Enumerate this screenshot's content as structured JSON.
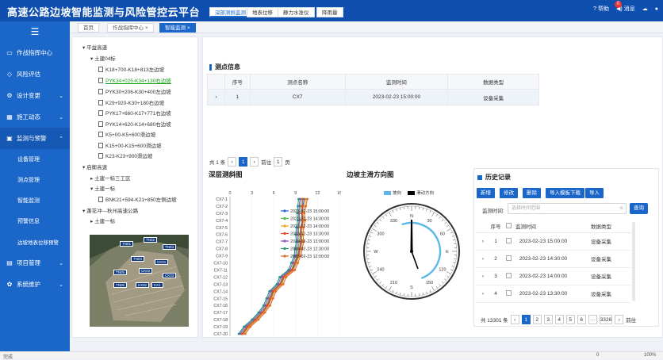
{
  "app": {
    "title": "高速公路边坡智能监测与风险管控云平台",
    "help": "帮助",
    "messages": "消息",
    "message_count": "0"
  },
  "sidebar": {
    "items": [
      {
        "label": "作战指挥中心",
        "icon": "monitor-icon"
      },
      {
        "label": "风险评估",
        "icon": "shield-icon"
      },
      {
        "label": "设计变更",
        "icon": "gear-icon"
      },
      {
        "label": "施工动态",
        "icon": "grid-icon"
      },
      {
        "label": "监测与预警",
        "icon": "alarm-icon"
      },
      {
        "label": "项目管理",
        "icon": "folder-icon"
      },
      {
        "label": "系统维护",
        "icon": "wrench-icon"
      }
    ],
    "sub_items": [
      "设备管理",
      "测点管理",
      "智能监测",
      "预警信息",
      "边坡地表位移预警"
    ]
  },
  "tabs": [
    "首页",
    "作战指挥中心",
    "智能监测"
  ],
  "tree": {
    "nodes": [
      "平益高速",
      "土建04标",
      "K18+700-K18+813左边坡",
      "PYK34+025-K34+130右边坡",
      "PYK30+206-K30+400左边坡",
      "K29+920-K30+180右边坡",
      "PYK17+660-K17+771右边坡",
      "PYK14+620-K14+680右边坡",
      "K5+00-K5+600滑边坡",
      "K15+00-K15+600滑边坡",
      "K23-K23+900滑边坡",
      "启衡高速",
      "土建一标三工区",
      "土建一标",
      "BNK21+594-K21+850左侧边坡",
      "蓬花冲—秋州高速公路",
      "土建一标"
    ]
  },
  "photo_labels": [
    "TN01",
    "TN02",
    "TN03",
    "CK01",
    "TN04",
    "CK02",
    "TN05",
    "CK03",
    "KX02",
    "TN06",
    "KX1"
  ],
  "subtabs": [
    "深部测斜监测",
    "地表位移",
    "静力水准仪",
    "降雨量"
  ],
  "points": {
    "heading": "测点信息",
    "columns": [
      "序号",
      "测点名称",
      "监测时间",
      "数据类型"
    ],
    "rows": [
      [
        "1",
        "CX7",
        "2023-02-23 15:00:00",
        "设备采集"
      ]
    ],
    "pager": {
      "total": "共 1 条",
      "page": "1",
      "goto_label": "前往",
      "goto_value": "1",
      "page_unit": "页"
    }
  },
  "deep_chart": {
    "title": "深层测斜图",
    "x_ticks": [
      "0",
      "3",
      "6",
      "9",
      "12",
      "15"
    ]
  },
  "compass": {
    "title": "边坡主滑方向图",
    "legend_slope": "坡向",
    "legend_slide": "滑动方向",
    "labels": [
      "N",
      "30",
      "60",
      "E",
      "120",
      "150",
      "S",
      "210",
      "240",
      "W",
      "300",
      "330"
    ],
    "slope_color": "#5bb8e8",
    "slide_color": "#000000"
  },
  "history": {
    "title": "历史记录",
    "buttons": [
      "新增",
      "修改",
      "删除",
      "导入模板下载",
      "导入"
    ],
    "search_label": "监测时间:",
    "search_placeholder": "选择时间范围",
    "search_button": "查询",
    "columns": [
      "序号",
      "监测时间",
      "数据类型"
    ],
    "rows": [
      [
        "1",
        "2023-02-23 15:00:00",
        "设备采集"
      ],
      [
        "2",
        "2023-02-23 14:30:00",
        "设备采集"
      ],
      [
        "3",
        "2023-02-23 14:00:00",
        "设备采集"
      ],
      [
        "4",
        "2023-02-23 13:30:00",
        "设备采集"
      ]
    ],
    "pager": {
      "total": "共 13301 条",
      "pages": [
        "1",
        "2",
        "3",
        "4",
        "5",
        "6",
        "···",
        "3326"
      ],
      "goto_label": "前往"
    }
  },
  "status": {
    "left": "完成",
    "zoom": "100%",
    "count": "0"
  },
  "chart_data": {
    "type": "line",
    "title": "深层测斜图",
    "categories": [
      "CX7-1",
      "CX7-2",
      "CX7-3",
      "CX7-4",
      "CX7-5",
      "CX7-6",
      "CX7-7",
      "CX7-8",
      "CX7-9",
      "CX7-10",
      "CX7-11",
      "CX7-12",
      "CX7-13",
      "CX7-14",
      "CX7-15",
      "CX7-16",
      "CX7-17",
      "CX7-18",
      "CX7-19",
      "CX7-20"
    ],
    "xlim": [
      0,
      15
    ],
    "series": [
      {
        "name": "2023-02-23 15:00:00",
        "color": "#2a63d6",
        "values": [
          10.2,
          10.0,
          9.9,
          10.0,
          9.8,
          9.7,
          9.8,
          9.6,
          9.4,
          9.0,
          8.6,
          7.4,
          7.0,
          6.0,
          5.6,
          5.2,
          4.5,
          3.6,
          2.5,
          1.8
        ]
      },
      {
        "name": "2023-02-23 14:30:00",
        "color": "#55b14a",
        "values": [
          9.8,
          9.7,
          9.5,
          9.6,
          9.4,
          9.4,
          9.5,
          9.3,
          9.2,
          8.8,
          8.4,
          7.2,
          6.8,
          5.8,
          5.4,
          5.0,
          4.3,
          3.4,
          2.3,
          1.6
        ]
      },
      {
        "name": "2023-02-23 14:00:00",
        "color": "#f0a11e",
        "values": [
          10.4,
          10.2,
          10.0,
          10.1,
          9.9,
          9.8,
          9.9,
          9.7,
          9.5,
          9.1,
          8.7,
          7.5,
          7.1,
          6.1,
          5.7,
          5.3,
          4.6,
          3.7,
          2.6,
          1.9
        ]
      },
      {
        "name": "2023-02-23 13:30:00",
        "color": "#e8452c",
        "values": [
          10.0,
          9.9,
          9.8,
          9.9,
          9.7,
          9.6,
          9.7,
          9.5,
          9.3,
          8.9,
          8.5,
          7.3,
          6.9,
          5.9,
          5.5,
          5.1,
          4.4,
          3.5,
          2.4,
          1.7
        ]
      },
      {
        "name": "2023-02-23 13:00:00",
        "color": "#8a4fc2",
        "values": [
          9.6,
          9.5,
          9.4,
          9.5,
          9.3,
          9.2,
          9.3,
          9.1,
          9.0,
          8.6,
          8.2,
          7.0,
          6.6,
          5.6,
          5.2,
          4.8,
          4.1,
          3.2,
          2.1,
          1.4
        ]
      },
      {
        "name": "2023-02-23 12:30:00",
        "color": "#1f9a7a",
        "values": [
          9.4,
          9.3,
          9.2,
          9.3,
          9.1,
          9.0,
          9.1,
          8.9,
          8.8,
          8.4,
          8.0,
          6.8,
          6.4,
          5.4,
          5.0,
          4.6,
          3.9,
          3.0,
          1.9,
          1.2
        ]
      },
      {
        "name": "2023-02-23 12:00:00",
        "color": "#d86a2a",
        "values": [
          10.6,
          10.4,
          10.2,
          10.3,
          10.1,
          10.0,
          10.1,
          9.9,
          9.7,
          9.3,
          8.9,
          7.7,
          7.3,
          6.3,
          5.9,
          5.5,
          4.8,
          3.9,
          2.8,
          2.1
        ]
      }
    ]
  }
}
